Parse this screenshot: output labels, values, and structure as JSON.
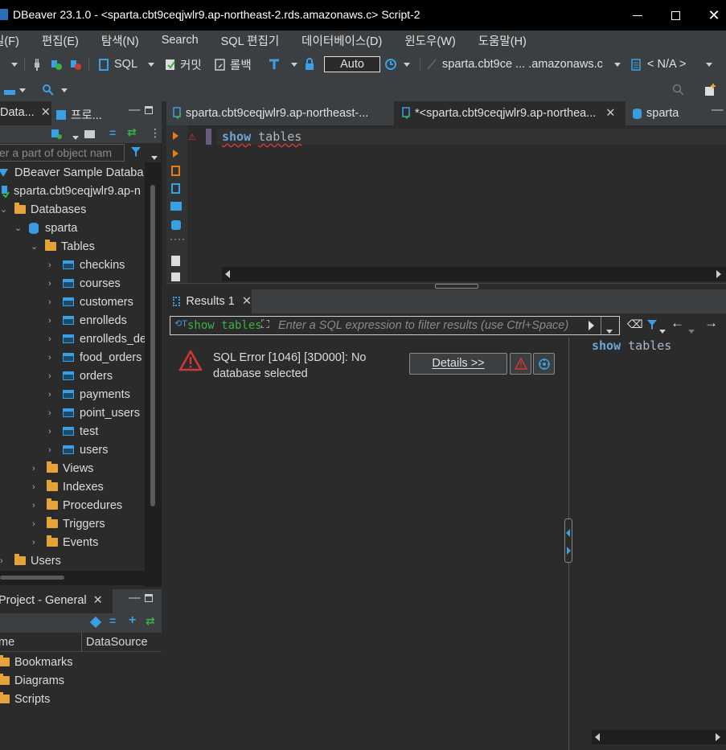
{
  "window": {
    "title": "DBeaver 23.1.0 - <sparta.cbt9ceqjwlr9.ap-northeast-2.rds.amazonaws.c> Script-2",
    "minimize": "—",
    "maximize": "☐",
    "close": "✕"
  },
  "menu": [
    "일(F)",
    "편집(E)",
    "탐색(N)",
    "Search",
    "SQL 편집기",
    "데이터베이스(D)",
    "윈도우(W)",
    "도움말(H)"
  ],
  "toolbar": {
    "sql_label": "SQL",
    "commit_label": "커밋",
    "rollback_label": "롤백",
    "transaction_mode": "Auto",
    "connection": "sparta.cbt9ce ... .amazonaws.c",
    "schema": "< N/A >"
  },
  "left_panel": {
    "tabs": [
      {
        "label": "Data..."
      },
      {
        "label": "프로..."
      }
    ],
    "filter_placeholder": "er a part of object nam",
    "tree": {
      "sample_db": "DBeaver Sample Databa",
      "connection": "sparta.cbt9ceqjwlr9.ap-n",
      "databases": "Databases",
      "schema": "sparta",
      "tables_folder": "Tables",
      "tables": [
        "checkins",
        "courses",
        "customers",
        "enrolleds",
        "enrolleds_de",
        "food_orders",
        "orders",
        "payments",
        "point_users",
        "test",
        "users"
      ],
      "folders": [
        "Views",
        "Indexes",
        "Procedures",
        "Triggers",
        "Events"
      ],
      "users": "Users"
    }
  },
  "project_panel": {
    "tab": "Project - General",
    "columns": [
      "me",
      "DataSource"
    ],
    "items": [
      "Bookmarks",
      "Diagrams",
      "Scripts"
    ]
  },
  "editor": {
    "tabs": [
      {
        "label": "sparta.cbt9ceqjwlr9.ap-northeast-..."
      },
      {
        "label": "*<sparta.cbt9ceqjwlr9.ap-northea..."
      },
      {
        "label": "sparta"
      }
    ],
    "code_keyword": "show",
    "code_ident": "tables"
  },
  "results": {
    "tab": "Results 1",
    "filter_query": "show tables",
    "filter_placeholder": "Enter a SQL expression to filter results (use Ctrl+Space)",
    "error_text": "SQL Error [1046] [3D000]: No database selected",
    "details_button": "Details >>",
    "side_keyword": "show",
    "side_ident": "tables"
  },
  "colors": {
    "background": "#2b2b2b",
    "panel": "#3c3f41",
    "keyword": "#6aa6d8",
    "folder": "#e6a33a",
    "error": "#d03838"
  }
}
